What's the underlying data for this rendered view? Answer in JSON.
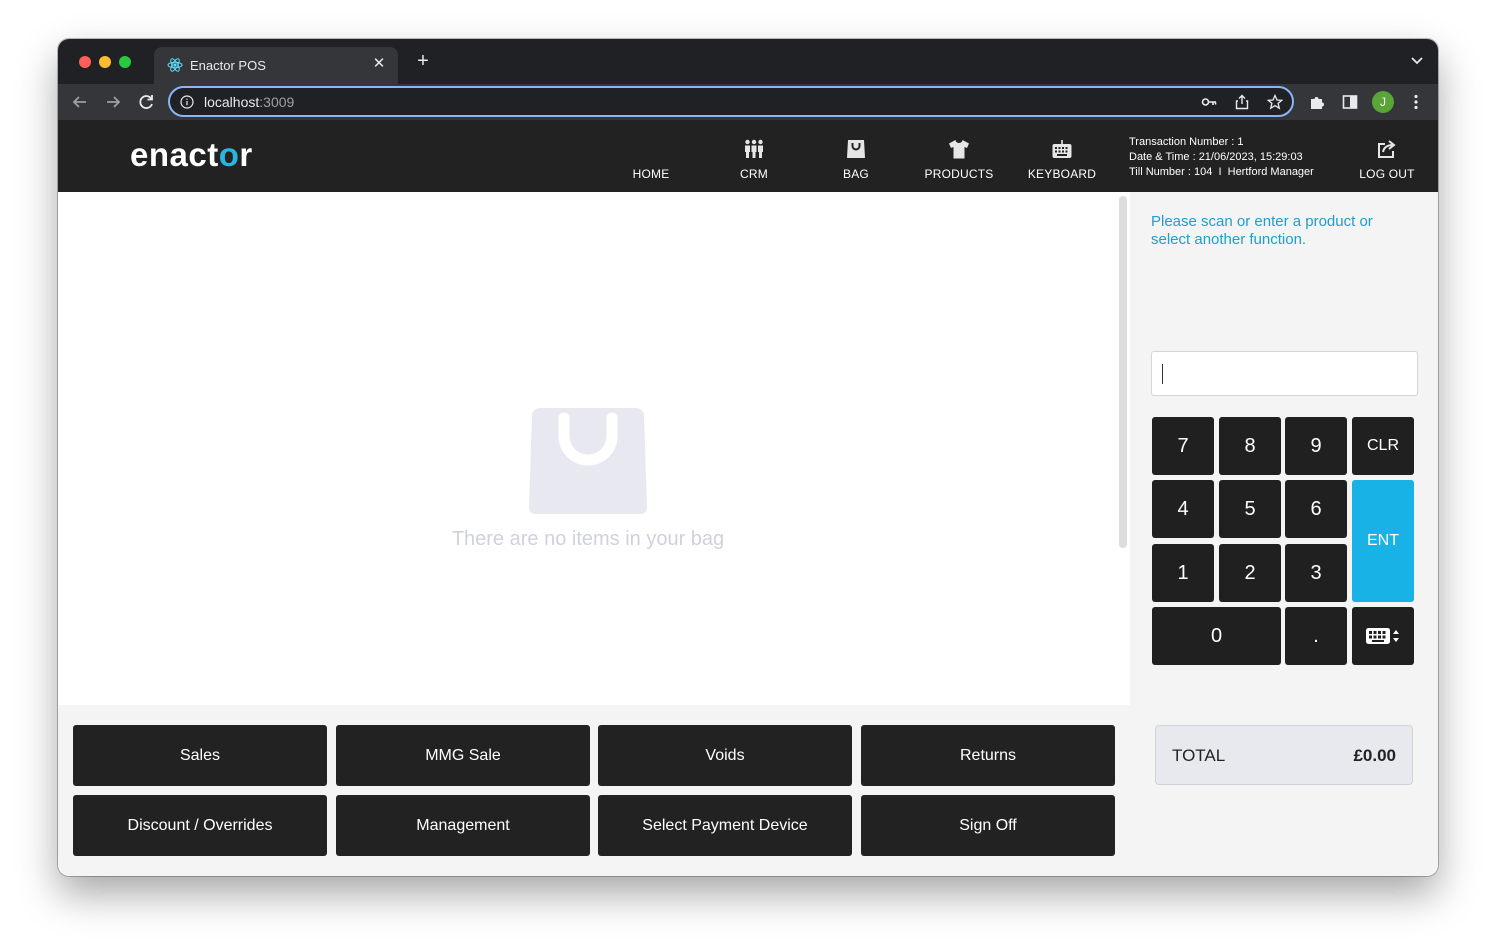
{
  "browser": {
    "tab_title": "Enactor POS",
    "tab_close": "✕",
    "new_tab": "+",
    "url_host": "localhost",
    "url_port": ":3009",
    "avatar_initial": "J"
  },
  "header": {
    "logo_pre": "enact",
    "logo_o": "o",
    "logo_post": "r",
    "nav": [
      {
        "label": "HOME",
        "icon": "home-icon"
      },
      {
        "label": "CRM",
        "icon": "people-icon"
      },
      {
        "label": "BAG",
        "icon": "bag-icon"
      },
      {
        "label": "PRODUCTS",
        "icon": "tshirt-icon"
      },
      {
        "label": "KEYBOARD",
        "icon": "keyboard-icon"
      },
      {
        "label": "LOG OUT",
        "icon": "logout-icon"
      }
    ],
    "transaction_number": "Transaction Number : 1",
    "date_time": "Date & Time : 21/06/2023, 15:29:03",
    "till": "Till Number : 104  I  Hertford Manager"
  },
  "bag": {
    "empty_message": "There are no items in your bag"
  },
  "right_panel": {
    "prompt": "Please scan or enter a product or select another function.",
    "entry_value": "",
    "keypad": {
      "k7": "7",
      "k8": "8",
      "k9": "9",
      "clr": "CLR",
      "k4": "4",
      "k5": "5",
      "k6": "6",
      "ent": "ENT",
      "k1": "1",
      "k2": "2",
      "k3": "3",
      "k0": "0",
      "dot": "."
    },
    "total_label": "TOTAL",
    "total_value": "£0.00"
  },
  "functions": {
    "sales": "Sales",
    "mmg_sale": "MMG Sale",
    "voids": "Voids",
    "returns": "Returns",
    "discount": "Discount / Overrides",
    "management": "Management",
    "select_payment": "Select Payment Device",
    "sign_off": "Sign Off"
  },
  "colors": {
    "accent": "#19b2e6",
    "header_bg": "#222222",
    "prompt_text": "#1a9fce"
  }
}
